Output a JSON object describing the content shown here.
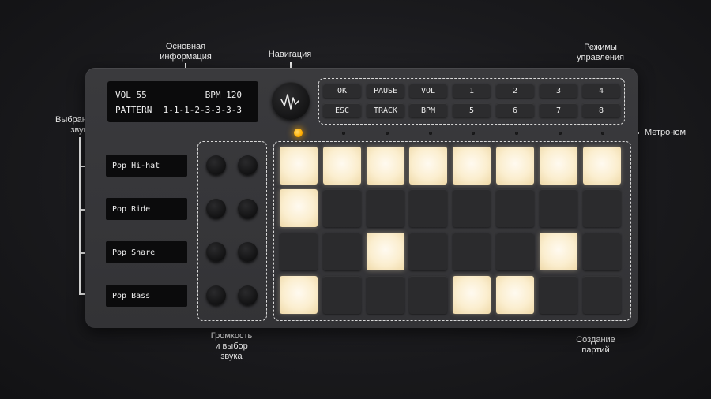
{
  "annotations": {
    "main_info": [
      "Основная",
      "информация"
    ],
    "navigation": "Навигация",
    "control_modes": [
      "Режимы",
      "управления"
    ],
    "selected_sound": [
      "Выбранный",
      "звук"
    ],
    "metronome": "Метроном",
    "volume_sound": [
      "Громкость",
      "и выбор",
      "звука"
    ],
    "create_parts": [
      "Создание",
      "партий"
    ]
  },
  "display": {
    "vol": "VOL 55",
    "bpm": "BPM 120",
    "pattern_label": "PATTERN",
    "pattern_value": "1-1-1-2-3-3-3-3"
  },
  "control_buttons": [
    [
      "OK",
      "PAUSE",
      "VOL",
      "1",
      "2",
      "3",
      "4"
    ],
    [
      "ESC",
      "TRACK",
      "BPM",
      "5",
      "6",
      "7",
      "8"
    ]
  ],
  "sounds": [
    "Pop Hi-hat",
    "Pop Ride",
    "Pop Snare",
    "Pop Bass"
  ],
  "pads": [
    [
      1,
      1,
      1,
      1,
      1,
      1,
      1,
      1
    ],
    [
      1,
      0,
      0,
      0,
      0,
      0,
      0,
      0
    ],
    [
      0,
      0,
      1,
      0,
      0,
      0,
      1,
      0
    ],
    [
      1,
      0,
      0,
      0,
      1,
      1,
      0,
      0
    ]
  ],
  "colors": {
    "pad_on": "#fbeecf",
    "pad_off": "#2b2b2d",
    "metronome_led": "#ffae00"
  },
  "icons": {
    "nav_logo": "waveform-logo-icon"
  }
}
